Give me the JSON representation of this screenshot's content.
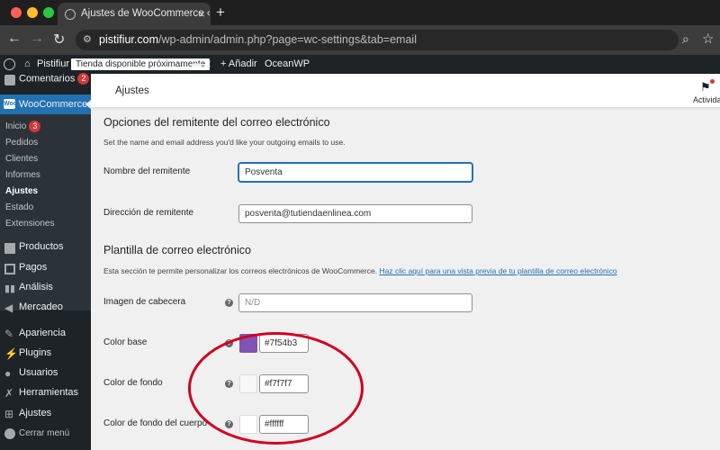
{
  "browser": {
    "tab_title": "Ajustes de WooCommerce ‹ P",
    "tab_close": "×",
    "new_tab": "+",
    "url_host": "pistifiur.com",
    "url_path": "/wp-admin/admin.php?page=wc-settings&tab=email"
  },
  "admin_bar": {
    "site_name": "Pistifiur",
    "store_badge": "Tienda disponible próximamente",
    "comments_count": "2",
    "add_new": "+ Añadir",
    "theme": "OceanWP"
  },
  "sidebar": {
    "comments": {
      "label": "Comentarios",
      "count": "2"
    },
    "woocommerce": "WooCommerce",
    "submenu": [
      {
        "label": "Inicio",
        "count": "3"
      },
      {
        "label": "Pedidos"
      },
      {
        "label": "Clientes"
      },
      {
        "label": "Informes"
      },
      {
        "label": "Ajustes"
      },
      {
        "label": "Estado"
      },
      {
        "label": "Extensiones"
      }
    ],
    "items": [
      "Productos",
      "Pagos",
      "Análisis",
      "Mercadeo",
      "Apariencia",
      "Plugins",
      "Usuarios",
      "Herramientas",
      "Ajustes"
    ],
    "collapse": "Cerrar menú"
  },
  "header": {
    "title": "Ajustes",
    "activity": "Actividad"
  },
  "sender_section": {
    "heading": "Opciones del remitente del correo electrónico",
    "description": "Set the name and email address you'd like your outgoing emails to use.",
    "fields": [
      {
        "label": "Nombre del remitente",
        "value": "Posventa"
      },
      {
        "label": "Dirección de remitente",
        "value": "posventa@tutiendaenlinea.com"
      }
    ]
  },
  "template_section": {
    "heading": "Plantilla de correo electrónico",
    "description": "Esta sección te permite personalizar los correos electrónicos de WooCommerce.",
    "link": "Haz clic aquí para una vista previa de tu plantilla de correo electrónico",
    "header_image": {
      "label": "Imagen de cabecera",
      "placeholder": "N/D"
    },
    "colors": [
      {
        "label": "Color base",
        "value": "#7f54b3"
      },
      {
        "label": "Color de fondo",
        "value": "#f7f7f7"
      },
      {
        "label": "Color de fondo del cuerpo",
        "value": "#ffffff"
      }
    ]
  },
  "colors": {
    "wp_blue": "#2271b1",
    "admin_dark": "#1d2327",
    "annotation_red": "#d2001f"
  }
}
